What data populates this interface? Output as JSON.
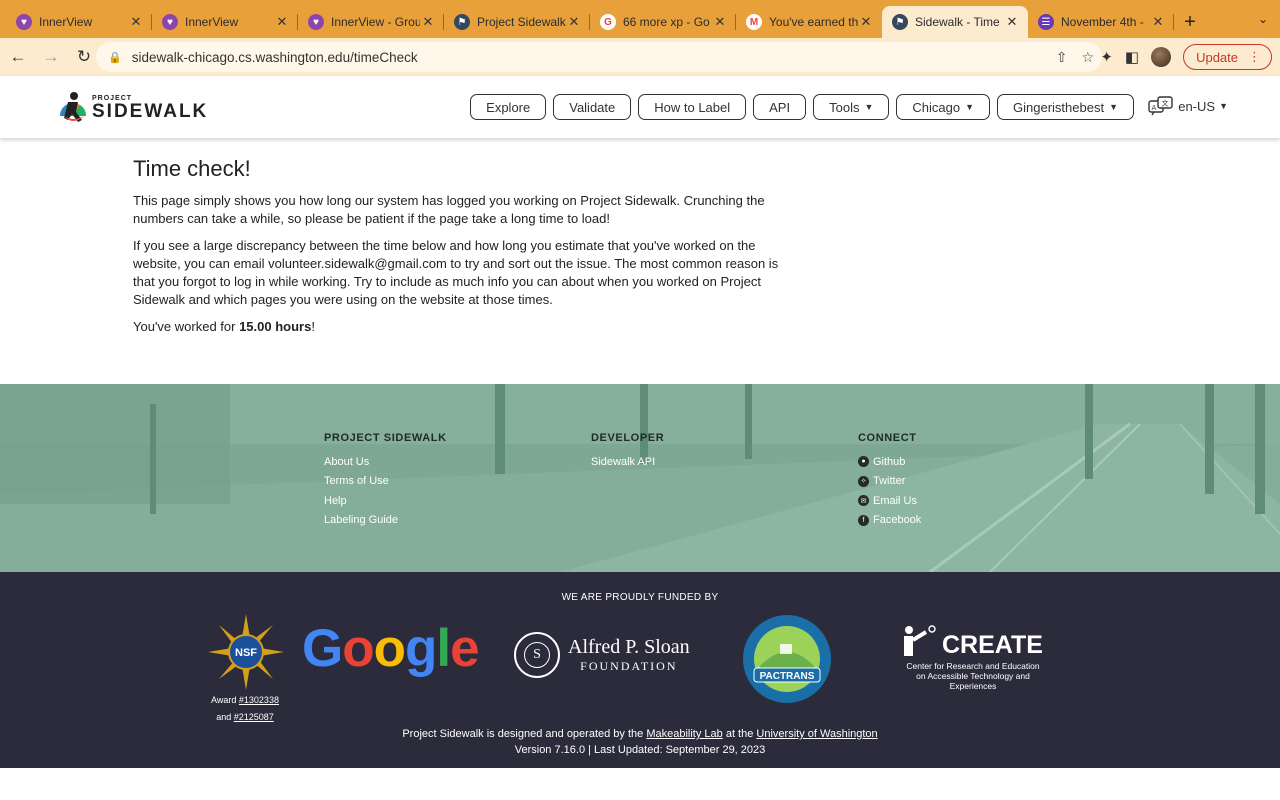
{
  "browser": {
    "tabs": [
      {
        "title": "InnerView",
        "favicon_color": "#8e44ad",
        "favicon_glyph": "♥"
      },
      {
        "title": "InnerView",
        "favicon_color": "#8e44ad",
        "favicon_glyph": "♥"
      },
      {
        "title": "InnerView - Grou",
        "favicon_color": "#8e44ad",
        "favicon_glyph": "♥"
      },
      {
        "title": "Project Sidewalk",
        "favicon_color": "#34495e",
        "favicon_glyph": "⚑"
      },
      {
        "title": "66 more xp - Go",
        "favicon_color": "#ffffff",
        "favicon_glyph": "G"
      },
      {
        "title": "You've earned th",
        "favicon_color": "#ffffff",
        "favicon_glyph": "M"
      },
      {
        "title": "Sidewalk - Time",
        "favicon_color": "#34495e",
        "favicon_glyph": "⚑",
        "active": true
      },
      {
        "title": "November 4th -",
        "favicon_color": "#673ab7",
        "favicon_glyph": "☰"
      }
    ],
    "url": "sidewalk-chicago.cs.washington.edu/timeCheck",
    "update_label": "Update"
  },
  "site": {
    "logo_small": "PROJECT",
    "logo_big": "SIDEWALK",
    "nav": [
      {
        "label": "Explore"
      },
      {
        "label": "Validate"
      },
      {
        "label": "How to Label"
      },
      {
        "label": "API"
      },
      {
        "label": "Tools",
        "dropdown": true
      },
      {
        "label": "Chicago",
        "dropdown": true
      },
      {
        "label": "Gingeristhebest",
        "dropdown": true
      }
    ],
    "language": "en-US"
  },
  "main": {
    "title": "Time check!",
    "para1": "This page simply shows you how long our system has logged you working on Project Sidewalk. Crunching the numbers can take a while, so please be patient if the page take a long time to load!",
    "para2": "If you see a large discrepancy between the time below and how long you estimate that you've worked on the website, you can email volunteer.sidewalk@gmail.com to try and sort out the issue. The most common reason is that you forgot to log in while working. Try to include as much info you can about when you worked on Project Sidewalk and which pages you were using on the website at those times.",
    "worked_prefix": "You've worked for ",
    "worked_hours": "15.00 hours",
    "worked_suffix": "!"
  },
  "footer": {
    "columns": [
      {
        "heading": "PROJECT SIDEWALK",
        "links": [
          {
            "label": "About Us"
          },
          {
            "label": "Terms of Use"
          },
          {
            "label": "Help"
          },
          {
            "label": "Labeling Guide"
          }
        ]
      },
      {
        "heading": "DEVELOPER",
        "links": [
          {
            "label": "Sidewalk API"
          }
        ]
      },
      {
        "heading": "CONNECT",
        "links": [
          {
            "label": "Github",
            "icon": "github-icon"
          },
          {
            "label": "Twitter",
            "icon": "twitter-icon"
          },
          {
            "label": "Email Us",
            "icon": "email-icon"
          },
          {
            "label": "Facebook",
            "icon": "facebook-icon"
          }
        ]
      }
    ],
    "funded_heading": "WE ARE PROUDLY FUNDED BY",
    "nsf_text": "NSF",
    "award_prefix": "Award ",
    "award_1": "#1302338",
    "award_and": "and ",
    "award_2": "#2125087",
    "google_letters": [
      "G",
      "o",
      "o",
      "g",
      "l",
      "e"
    ],
    "google_colors": [
      "#4285f4",
      "#ea4335",
      "#fbbc05",
      "#4285f4",
      "#34a853",
      "#ea4335"
    ],
    "sloan_seal": "S",
    "sloan_name": "Alfred P. Sloan",
    "sloan_sub": "FOUNDATION",
    "pactrans_text": "PACTRANS",
    "create_word": "CREATE",
    "create_desc": "Center for Research and Education on Accessible Technology and Experiences",
    "credits_prefix": "Project Sidewalk is designed and operated by the ",
    "credits_lab": "Makeability Lab",
    "credits_mid": " at the ",
    "credits_uni": "University of Washington",
    "version_line": "Version 7.16.0 | Last Updated: September 29, 2023"
  }
}
